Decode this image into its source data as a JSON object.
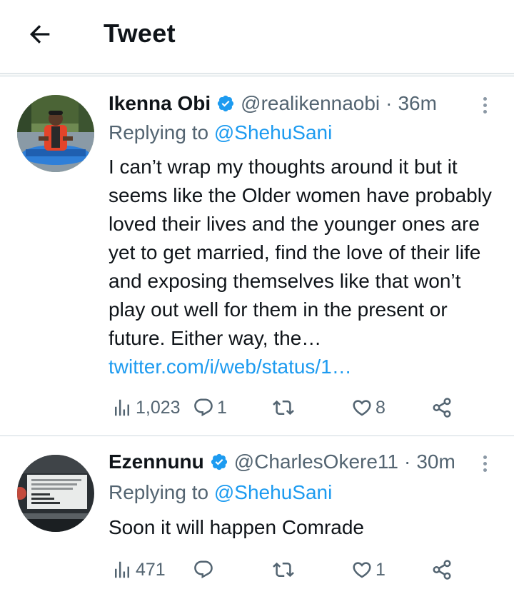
{
  "header": {
    "title": "Tweet"
  },
  "colors": {
    "accent": "#1d9bf0",
    "secondary_text": "#536471",
    "divider": "#cfd9de"
  },
  "tweets": [
    {
      "name": "Ikenna Obi",
      "handle": "@realikennaobi",
      "separator": "·",
      "time": "36m",
      "replying_prefix": "Replying to",
      "replying_to": "@ShehuSani",
      "text": "I can’t wrap my thoughts around it but it seems like the Older women have probably loved their lives and the younger ones are yet to get married, find the love of their life and exposing themselves like that won’t play out well for them in the present or future. Either way, the…",
      "link": "twitter.com/i/web/status/1…",
      "views": "1,023",
      "replies": "1",
      "retweets": "",
      "likes": "8"
    },
    {
      "name": "Ezennunu",
      "handle": "@CharlesOkere11",
      "separator": "·",
      "time": "30m",
      "replying_prefix": "Replying to",
      "replying_to": "@ShehuSani",
      "text": "Soon it will happen Comrade",
      "link": "",
      "views": "471",
      "replies": "",
      "retweets": "",
      "likes": "1"
    }
  ]
}
